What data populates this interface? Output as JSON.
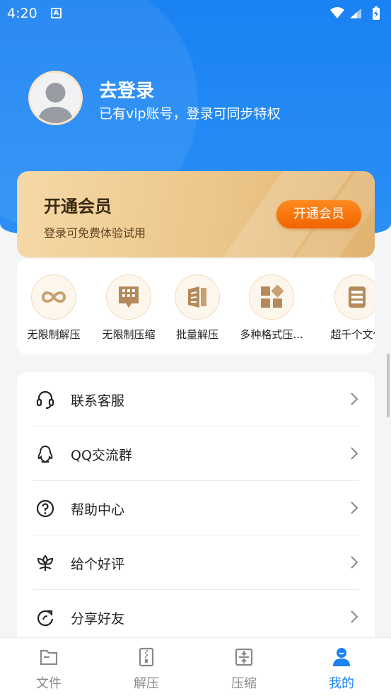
{
  "status_bar": {
    "time": "4:20",
    "badge": "A"
  },
  "profile": {
    "login_title": "去登录",
    "login_subtitle": "已有vip账号，登录可同步特权"
  },
  "vip_card": {
    "title": "开通会员",
    "subtitle": "登录可免费体验试用",
    "button_label": "开通会员"
  },
  "features": [
    {
      "label": "无限制解压",
      "icon": "infinity-icon"
    },
    {
      "label": "无限制压缩",
      "icon": "grid-doc-icon"
    },
    {
      "label": "批量解压",
      "icon": "batch-books-icon"
    },
    {
      "label": "多种格式压...",
      "icon": "multi-format-icon"
    },
    {
      "label": "超千个文件",
      "icon": "file-stack-icon"
    }
  ],
  "menu": [
    {
      "label": "联系客服",
      "icon": "headset-icon"
    },
    {
      "label": "QQ交流群",
      "icon": "qq-penguin-icon"
    },
    {
      "label": "帮助中心",
      "icon": "question-circle-icon"
    },
    {
      "label": "给个好评",
      "icon": "flower-icon"
    },
    {
      "label": "分享好友",
      "icon": "share-refresh-icon"
    }
  ],
  "tabs": [
    {
      "label": "文件",
      "icon": "folder-icon",
      "active": false
    },
    {
      "label": "解压",
      "icon": "unzip-icon",
      "active": false
    },
    {
      "label": "压缩",
      "icon": "compress-icon",
      "active": false
    },
    {
      "label": "我的",
      "icon": "user-icon",
      "active": true
    }
  ],
  "colors": {
    "primary_blue": "#1a82f3",
    "vip_gold": "#ecc68a",
    "vip_button": "#f06400",
    "feature_icon_bg": "#fdf6ec"
  }
}
